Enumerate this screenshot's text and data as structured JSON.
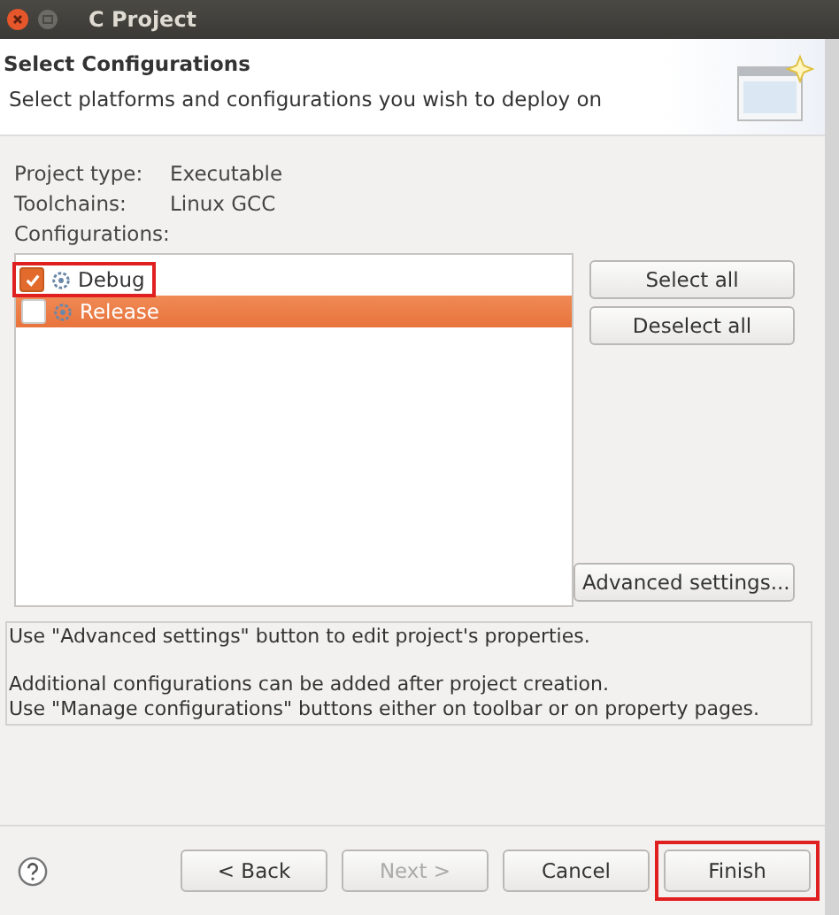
{
  "window": {
    "title": "C Project"
  },
  "header": {
    "title": "Select Configurations",
    "subtitle": "Select platforms and configurations you wish to deploy on"
  },
  "info": [
    {
      "label": "Project type:",
      "value": "Executable"
    },
    {
      "label": "Toolchains:",
      "value": "Linux GCC"
    },
    {
      "label": "Configurations:"
    }
  ],
  "configurations": [
    {
      "name": "Debug",
      "checked": true,
      "selected": false,
      "highlighted": true
    },
    {
      "name": "Release",
      "checked": false,
      "selected": true,
      "highlighted": false
    }
  ],
  "side_buttons": [
    "Select all",
    "Deselect all"
  ],
  "advanced_button": "Advanced settings...",
  "description": [
    [
      "Use \"Advanced settings\" button to edit project's properties."
    ],
    [
      "Additional configurations can be added after project creation.",
      "Use \"Manage configurations\" buttons either on toolbar or on property pages."
    ]
  ],
  "footer_buttons": [
    {
      "label": "< Back",
      "disabled": false,
      "highlighted": false
    },
    {
      "label": "Next >",
      "disabled": true,
      "highlighted": false
    },
    {
      "label": "Cancel",
      "disabled": false,
      "highlighted": false
    },
    {
      "label": "Finish",
      "disabled": false,
      "highlighted": true
    }
  ]
}
